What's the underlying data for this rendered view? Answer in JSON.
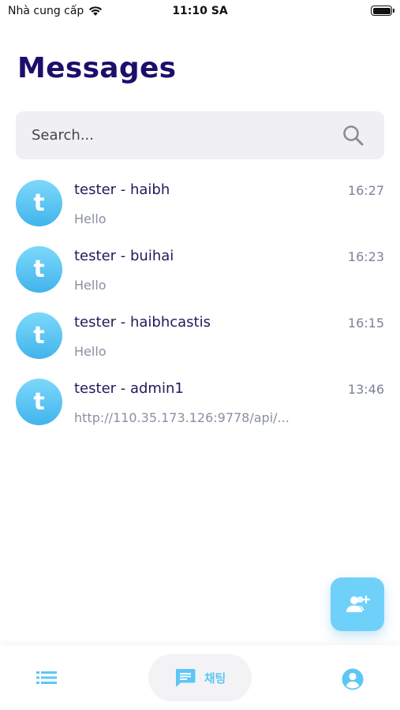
{
  "status_bar": {
    "carrier": "Nhà cung cấp",
    "time": "11:10 SA"
  },
  "header": {
    "title": "Messages"
  },
  "search": {
    "placeholder": "Search...",
    "icon": "search-icon"
  },
  "conversations": [
    {
      "avatar_letter": "t",
      "name": "tester - haibh",
      "time": "16:27",
      "preview": "Hello"
    },
    {
      "avatar_letter": "t",
      "name": "tester - buihai",
      "time": "16:23",
      "preview": "Hello"
    },
    {
      "avatar_letter": "t",
      "name": "tester - haibhcastis",
      "time": "16:15",
      "preview": "Hello"
    },
    {
      "avatar_letter": "t",
      "name": "tester - admin1",
      "time": "13:46",
      "preview": "http://110.35.173.126:9778/api/..."
    }
  ],
  "fab": {
    "icon": "add-user-icon"
  },
  "bottom_nav": {
    "items": [
      {
        "icon": "list-icon",
        "label": ""
      },
      {
        "icon": "chat-icon",
        "label": "채팅",
        "active": true
      },
      {
        "icon": "account-icon",
        "label": ""
      }
    ]
  },
  "colors": {
    "title": "#1b0f6b",
    "accent": "#6fd1f9",
    "avatar_gradient_top": "#7dd8fa",
    "avatar_gradient_bottom": "#41b4ec"
  }
}
